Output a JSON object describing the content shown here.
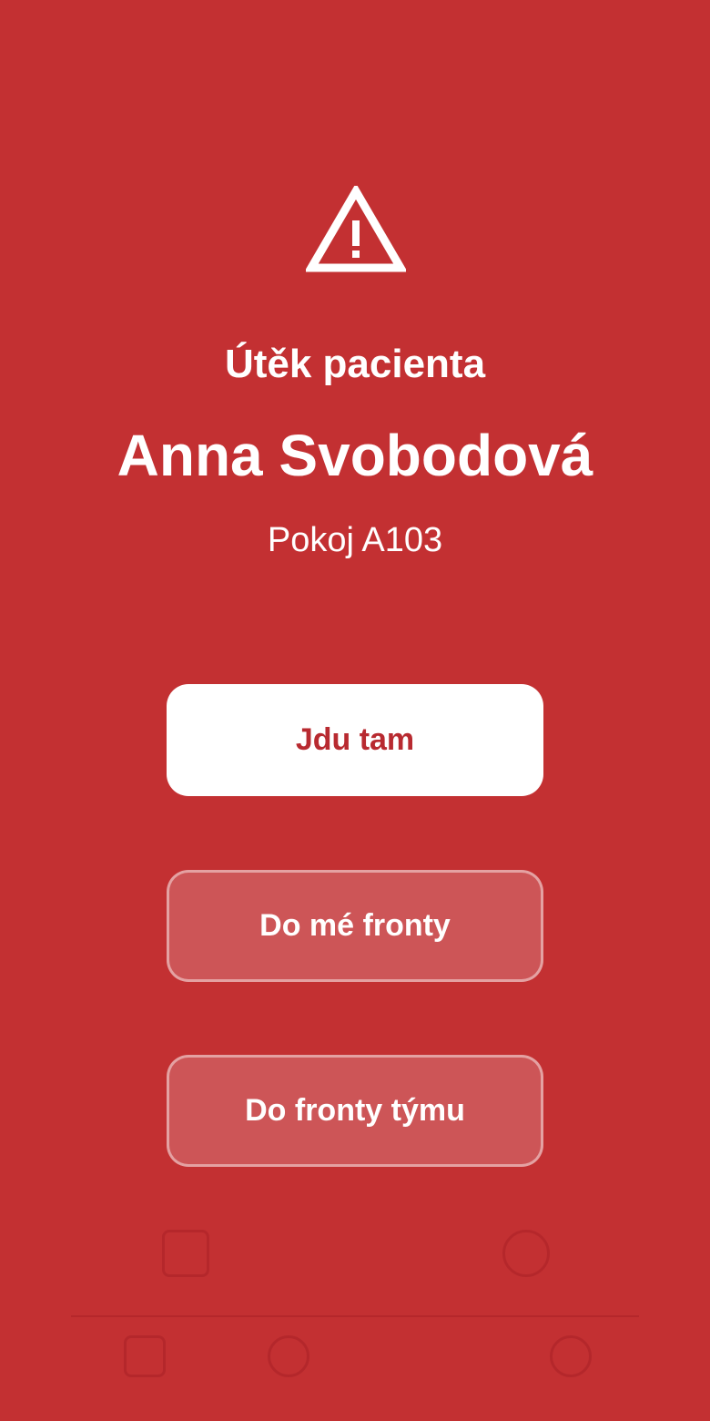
{
  "alert": {
    "icon": "warning-icon",
    "title": "Útěk pacienta",
    "patient_name": "Anna Svobodová",
    "room": "Pokoj A103"
  },
  "actions": {
    "go_label": "Jdu tam",
    "my_queue_label": "Do mé fronty",
    "team_queue_label": "Do fronty týmu"
  },
  "colors": {
    "background": "#c33032",
    "primary_button_bg": "#ffffff",
    "primary_button_text": "#b82a30"
  }
}
